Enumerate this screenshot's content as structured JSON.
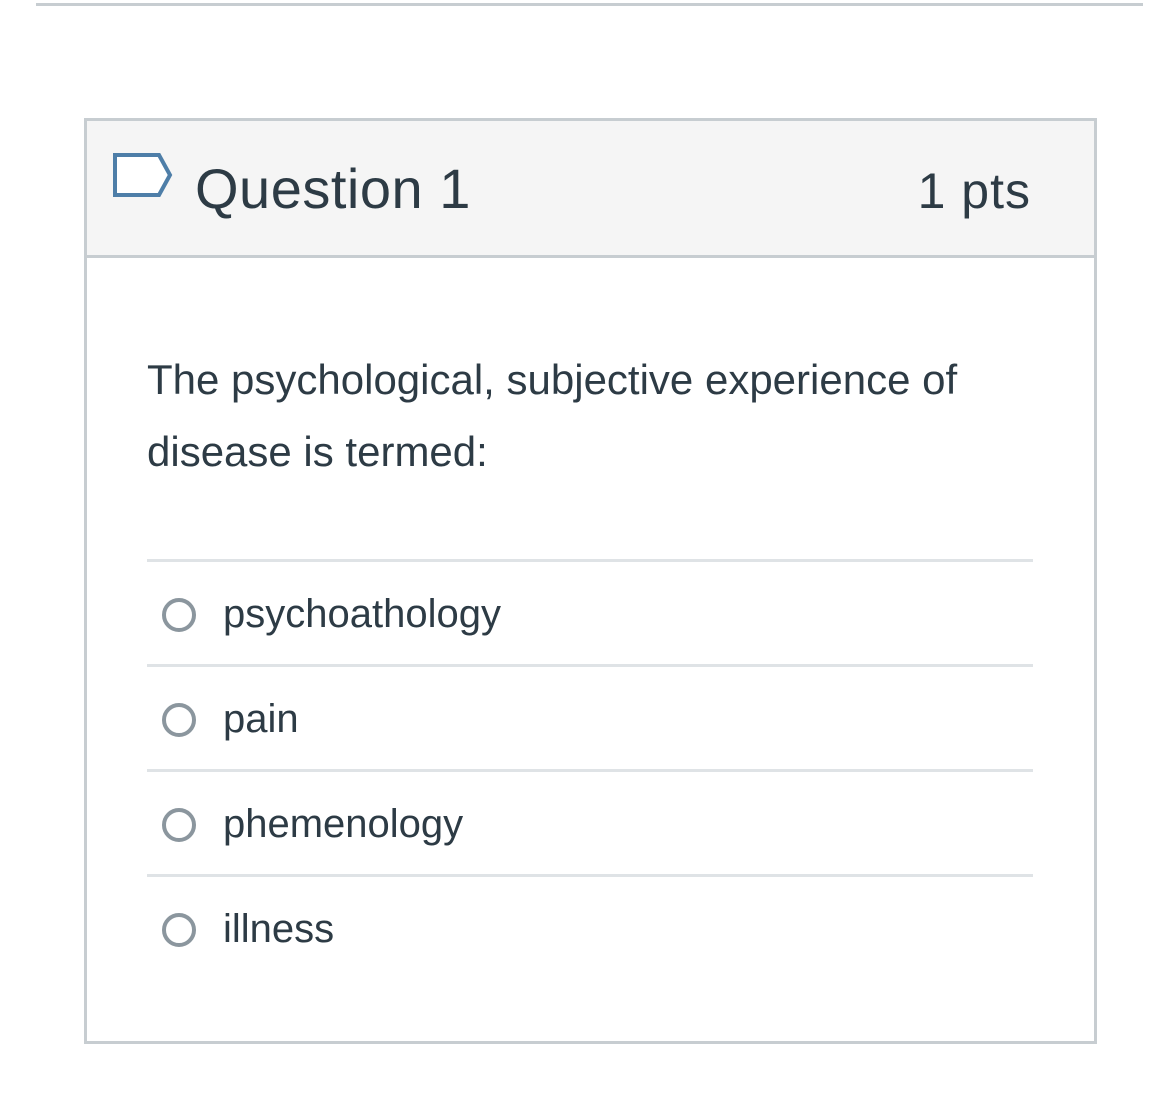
{
  "question": {
    "title": "Question 1",
    "points": "1 pts",
    "flag_icon": "flag-outline-icon",
    "text": "The psychological, subjective experience of disease is termed:",
    "answers": [
      {
        "label": "psychoathology",
        "selected": false
      },
      {
        "label": "pain",
        "selected": false
      },
      {
        "label": "phemenology",
        "selected": false
      },
      {
        "label": "illness",
        "selected": false
      }
    ]
  },
  "colors": {
    "text": "#2d3b45",
    "border": "#c7cdd1",
    "header_background": "#f5f5f5",
    "flag_stroke": "#4e7ea8",
    "radio_border": "#8b969e",
    "answer_divider": "#dfe3e6"
  }
}
